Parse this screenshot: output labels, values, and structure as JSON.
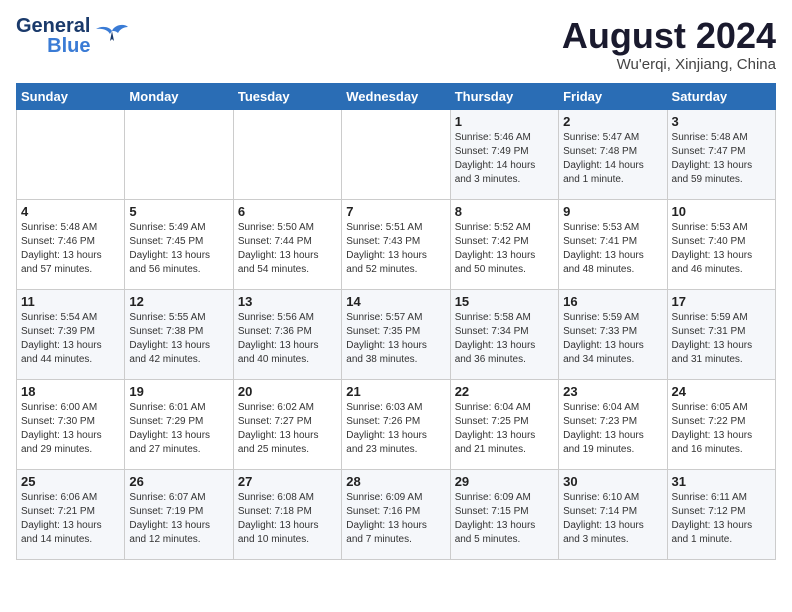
{
  "header": {
    "logo_line1": "General",
    "logo_line2": "Blue",
    "title": "August 2024",
    "subtitle": "Wu'erqi, Xinjiang, China"
  },
  "weekdays": [
    "Sunday",
    "Monday",
    "Tuesday",
    "Wednesday",
    "Thursday",
    "Friday",
    "Saturday"
  ],
  "weeks": [
    [
      {
        "day": "",
        "info": ""
      },
      {
        "day": "",
        "info": ""
      },
      {
        "day": "",
        "info": ""
      },
      {
        "day": "",
        "info": ""
      },
      {
        "day": "1",
        "info": "Sunrise: 5:46 AM\nSunset: 7:49 PM\nDaylight: 14 hours\nand 3 minutes."
      },
      {
        "day": "2",
        "info": "Sunrise: 5:47 AM\nSunset: 7:48 PM\nDaylight: 14 hours\nand 1 minute."
      },
      {
        "day": "3",
        "info": "Sunrise: 5:48 AM\nSunset: 7:47 PM\nDaylight: 13 hours\nand 59 minutes."
      }
    ],
    [
      {
        "day": "4",
        "info": "Sunrise: 5:48 AM\nSunset: 7:46 PM\nDaylight: 13 hours\nand 57 minutes."
      },
      {
        "day": "5",
        "info": "Sunrise: 5:49 AM\nSunset: 7:45 PM\nDaylight: 13 hours\nand 56 minutes."
      },
      {
        "day": "6",
        "info": "Sunrise: 5:50 AM\nSunset: 7:44 PM\nDaylight: 13 hours\nand 54 minutes."
      },
      {
        "day": "7",
        "info": "Sunrise: 5:51 AM\nSunset: 7:43 PM\nDaylight: 13 hours\nand 52 minutes."
      },
      {
        "day": "8",
        "info": "Sunrise: 5:52 AM\nSunset: 7:42 PM\nDaylight: 13 hours\nand 50 minutes."
      },
      {
        "day": "9",
        "info": "Sunrise: 5:53 AM\nSunset: 7:41 PM\nDaylight: 13 hours\nand 48 minutes."
      },
      {
        "day": "10",
        "info": "Sunrise: 5:53 AM\nSunset: 7:40 PM\nDaylight: 13 hours\nand 46 minutes."
      }
    ],
    [
      {
        "day": "11",
        "info": "Sunrise: 5:54 AM\nSunset: 7:39 PM\nDaylight: 13 hours\nand 44 minutes."
      },
      {
        "day": "12",
        "info": "Sunrise: 5:55 AM\nSunset: 7:38 PM\nDaylight: 13 hours\nand 42 minutes."
      },
      {
        "day": "13",
        "info": "Sunrise: 5:56 AM\nSunset: 7:36 PM\nDaylight: 13 hours\nand 40 minutes."
      },
      {
        "day": "14",
        "info": "Sunrise: 5:57 AM\nSunset: 7:35 PM\nDaylight: 13 hours\nand 38 minutes."
      },
      {
        "day": "15",
        "info": "Sunrise: 5:58 AM\nSunset: 7:34 PM\nDaylight: 13 hours\nand 36 minutes."
      },
      {
        "day": "16",
        "info": "Sunrise: 5:59 AM\nSunset: 7:33 PM\nDaylight: 13 hours\nand 34 minutes."
      },
      {
        "day": "17",
        "info": "Sunrise: 5:59 AM\nSunset: 7:31 PM\nDaylight: 13 hours\nand 31 minutes."
      }
    ],
    [
      {
        "day": "18",
        "info": "Sunrise: 6:00 AM\nSunset: 7:30 PM\nDaylight: 13 hours\nand 29 minutes."
      },
      {
        "day": "19",
        "info": "Sunrise: 6:01 AM\nSunset: 7:29 PM\nDaylight: 13 hours\nand 27 minutes."
      },
      {
        "day": "20",
        "info": "Sunrise: 6:02 AM\nSunset: 7:27 PM\nDaylight: 13 hours\nand 25 minutes."
      },
      {
        "day": "21",
        "info": "Sunrise: 6:03 AM\nSunset: 7:26 PM\nDaylight: 13 hours\nand 23 minutes."
      },
      {
        "day": "22",
        "info": "Sunrise: 6:04 AM\nSunset: 7:25 PM\nDaylight: 13 hours\nand 21 minutes."
      },
      {
        "day": "23",
        "info": "Sunrise: 6:04 AM\nSunset: 7:23 PM\nDaylight: 13 hours\nand 19 minutes."
      },
      {
        "day": "24",
        "info": "Sunrise: 6:05 AM\nSunset: 7:22 PM\nDaylight: 13 hours\nand 16 minutes."
      }
    ],
    [
      {
        "day": "25",
        "info": "Sunrise: 6:06 AM\nSunset: 7:21 PM\nDaylight: 13 hours\nand 14 minutes."
      },
      {
        "day": "26",
        "info": "Sunrise: 6:07 AM\nSunset: 7:19 PM\nDaylight: 13 hours\nand 12 minutes."
      },
      {
        "day": "27",
        "info": "Sunrise: 6:08 AM\nSunset: 7:18 PM\nDaylight: 13 hours\nand 10 minutes."
      },
      {
        "day": "28",
        "info": "Sunrise: 6:09 AM\nSunset: 7:16 PM\nDaylight: 13 hours\nand 7 minutes."
      },
      {
        "day": "29",
        "info": "Sunrise: 6:09 AM\nSunset: 7:15 PM\nDaylight: 13 hours\nand 5 minutes."
      },
      {
        "day": "30",
        "info": "Sunrise: 6:10 AM\nSunset: 7:14 PM\nDaylight: 13 hours\nand 3 minutes."
      },
      {
        "day": "31",
        "info": "Sunrise: 6:11 AM\nSunset: 7:12 PM\nDaylight: 13 hours\nand 1 minute."
      }
    ]
  ]
}
